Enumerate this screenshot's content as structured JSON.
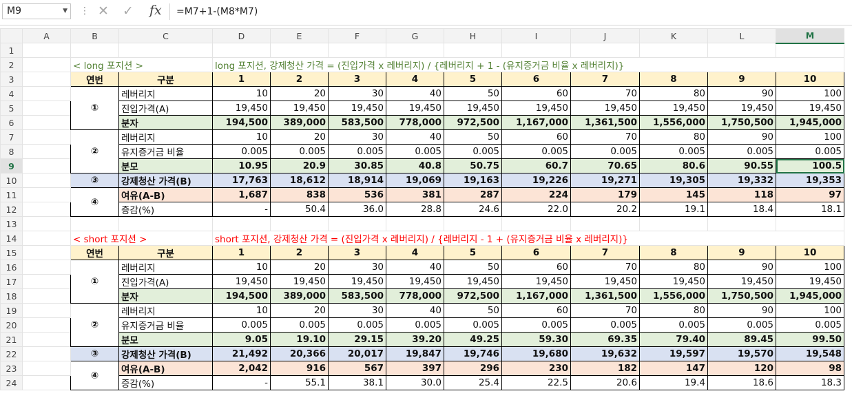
{
  "formula_bar": {
    "name_box": "M9",
    "fx": "fx",
    "formula": "=M7+1-(M8*M7)"
  },
  "columns": [
    "A",
    "B",
    "C",
    "D",
    "E",
    "F",
    "G",
    "H",
    "I",
    "J",
    "K",
    "L",
    "M"
  ],
  "rows": [
    "1",
    "2",
    "3",
    "4",
    "5",
    "6",
    "7",
    "8",
    "9",
    "10",
    "11",
    "12",
    "13",
    "14",
    "15",
    "16",
    "17",
    "18",
    "19",
    "20",
    "21",
    "22",
    "23",
    "24"
  ],
  "long": {
    "title": "< long 포지션 >",
    "formula_text": "long 포지션, 강제청산 가격 = (진입가격 x 레버리지) / {레버리지 + 1 - (유지증거금 비율 x 레버리지)}",
    "h_seq": "연번",
    "h_cat": "구분",
    "cols": [
      "1",
      "2",
      "3",
      "4",
      "5",
      "6",
      "7",
      "8",
      "9",
      "10"
    ],
    "g1": "①",
    "g2": "②",
    "g3": "③",
    "g4": "④",
    "r4_label": "레버리지",
    "r4": [
      "10",
      "20",
      "30",
      "40",
      "50",
      "60",
      "70",
      "80",
      "90",
      "100"
    ],
    "r5_label": "진입가격(A)",
    "r5": [
      "19,450",
      "19,450",
      "19,450",
      "19,450",
      "19,450",
      "19,450",
      "19,450",
      "19,450",
      "19,450",
      "19,450"
    ],
    "r6_label": "분자",
    "r6": [
      "194,500",
      "389,000",
      "583,500",
      "778,000",
      "972,500",
      "1,167,000",
      "1,361,500",
      "1,556,000",
      "1,750,500",
      "1,945,000"
    ],
    "r7_label": "레버리지",
    "r7": [
      "10",
      "20",
      "30",
      "40",
      "50",
      "60",
      "70",
      "80",
      "90",
      "100"
    ],
    "r8_label": "유지증거금 비율",
    "r8": [
      "0.005",
      "0.005",
      "0.005",
      "0.005",
      "0.005",
      "0.005",
      "0.005",
      "0.005",
      "0.005",
      "0.005"
    ],
    "r9_label": "분모",
    "r9": [
      "10.95",
      "20.9",
      "30.85",
      "40.8",
      "50.75",
      "60.7",
      "70.65",
      "80.6",
      "90.55",
      "100.5"
    ],
    "r10_label": "강제청산 가격(B)",
    "r10": [
      "17,763",
      "18,612",
      "18,914",
      "19,069",
      "19,163",
      "19,226",
      "19,271",
      "19,305",
      "19,332",
      "19,353"
    ],
    "r11_label": "여유(A-B)",
    "r11": [
      "1,687",
      "838",
      "536",
      "381",
      "287",
      "224",
      "179",
      "145",
      "118",
      "97"
    ],
    "r12_label": "증감(%)",
    "r12": [
      "-",
      "50.4",
      "36.0",
      "28.8",
      "24.6",
      "22.0",
      "20.2",
      "19.1",
      "18.4",
      "18.1"
    ]
  },
  "short": {
    "title": "< short 포지션 >",
    "formula_text": "short 포지션, 강제청산 가격 = (진입가격 x 레버리지) / {레버리지 - 1 + (유지증거금 비율 x 레버리지)}",
    "h_seq": "연번",
    "h_cat": "구분",
    "cols": [
      "1",
      "2",
      "3",
      "4",
      "5",
      "6",
      "7",
      "8",
      "9",
      "10"
    ],
    "g1": "①",
    "g2": "②",
    "g3": "③",
    "g4": "④",
    "r16_label": "레버리지",
    "r16": [
      "10",
      "20",
      "30",
      "40",
      "50",
      "60",
      "70",
      "80",
      "90",
      "100"
    ],
    "r17_label": "진입가격(A)",
    "r17": [
      "19,450",
      "19,450",
      "19,450",
      "19,450",
      "19,450",
      "19,450",
      "19,450",
      "19,450",
      "19,450",
      "19,450"
    ],
    "r18_label": "분자",
    "r18": [
      "194,500",
      "389,000",
      "583,500",
      "778,000",
      "972,500",
      "1,167,000",
      "1,361,500",
      "1,556,000",
      "1,750,500",
      "1,945,000"
    ],
    "r19_label": "레버리지",
    "r19": [
      "10",
      "20",
      "30",
      "40",
      "50",
      "60",
      "70",
      "80",
      "90",
      "100"
    ],
    "r20_label": "유지증거금 비율",
    "r20": [
      "0.005",
      "0.005",
      "0.005",
      "0.005",
      "0.005",
      "0.005",
      "0.005",
      "0.005",
      "0.005",
      "0.005"
    ],
    "r21_label": "분모",
    "r21": [
      "9.05",
      "19.10",
      "29.15",
      "39.20",
      "49.25",
      "59.30",
      "69.35",
      "79.40",
      "89.45",
      "99.50"
    ],
    "r22_label": "강제청산 가격(B)",
    "r22": [
      "21,492",
      "20,366",
      "20,017",
      "19,847",
      "19,746",
      "19,680",
      "19,632",
      "19,597",
      "19,570",
      "19,548"
    ],
    "r23_label": "여유(A-B)",
    "r23": [
      "2,042",
      "916",
      "567",
      "397",
      "296",
      "230",
      "182",
      "147",
      "120",
      "98"
    ],
    "r24_label": "증감(%)",
    "r24": [
      "-",
      "55.1",
      "38.1",
      "30.0",
      "25.4",
      "22.5",
      "20.6",
      "19.4",
      "18.6",
      "18.3"
    ]
  },
  "colors": {
    "header_fill": "#fff2cc",
    "green_fill": "#e2efda",
    "blue_fill": "#d9e1f2",
    "pink_fill": "#fce4d6",
    "long_text": "#548235",
    "short_text": "#ff0000",
    "select": "#217346"
  }
}
